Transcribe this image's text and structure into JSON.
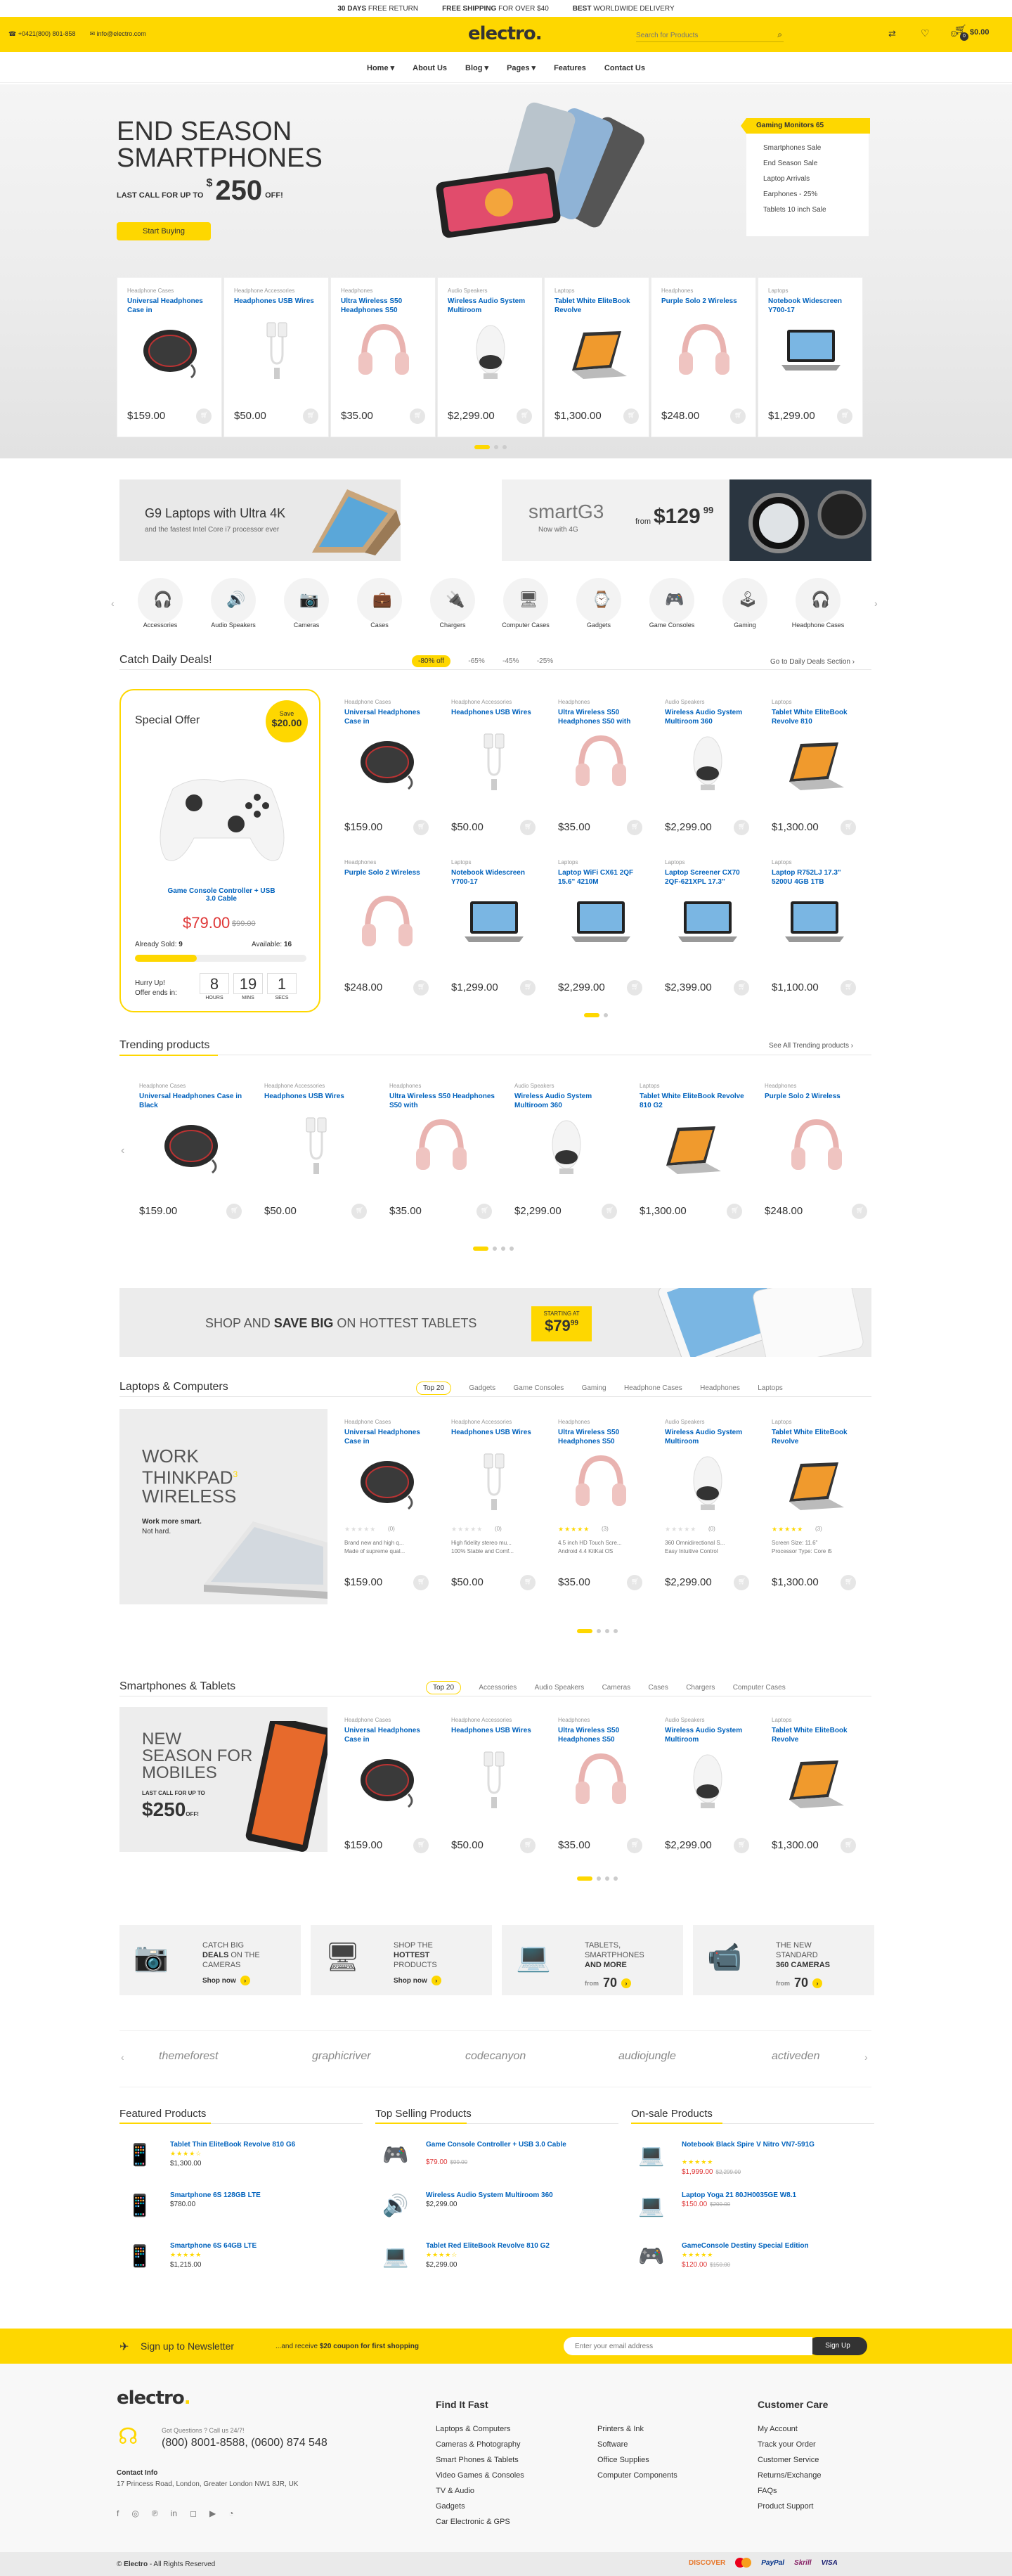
{
  "topbar": {
    "items": [
      {
        "bold": "30 DAYS",
        "text": " FREE RETURN"
      },
      {
        "bold": "FREE SHIPPING",
        "text": " FOR OVER $40"
      },
      {
        "bold": "BEST",
        "text": " WORLDWIDE DELIVERY"
      }
    ]
  },
  "header": {
    "phone": "+0421(800) 801-858",
    "email": "info@electro.com",
    "logo": "electro",
    "search_placeholder": "Search for Products",
    "cart_count": "0",
    "cart_total": "$0.00"
  },
  "nav": [
    "Home",
    "About Us",
    "Blog",
    "Pages",
    "Features",
    "Contact Us"
  ],
  "hero": {
    "line1": "END SEASON",
    "line2": "SMARTPHONES",
    "last_call": "LAST CALL FOR UP TO",
    "currency": "$",
    "amount": "250",
    "off": "OFF!",
    "button": "Start Buying",
    "side_menu": [
      "Gaming Monitors 65",
      "Smartphones Sale",
      "End Season Sale",
      "Laptop Arrivals",
      "Earphones - 25%",
      "Tablets 10 inch Sale"
    ]
  },
  "hero_products": [
    {
      "cat": "Headphone Cases",
      "title": "Universal Headphones Case in",
      "price": "$159.00",
      "img": "case"
    },
    {
      "cat": "Headphone Accessories",
      "title": "Headphones USB Wires",
      "price": "$50.00",
      "img": "wire"
    },
    {
      "cat": "Headphones",
      "title": "Ultra Wireless S50 Headphones S50",
      "price": "$35.00",
      "img": "headphones"
    },
    {
      "cat": "Audio Speakers",
      "title": "Wireless Audio System Multiroom",
      "price": "$2,299.00",
      "img": "speaker"
    },
    {
      "cat": "Laptops",
      "title": "Tablet White EliteBook Revolve",
      "price": "$1,300.00",
      "img": "laptop"
    },
    {
      "cat": "Headphones",
      "title": "Purple Solo 2 Wireless",
      "price": "$248.00",
      "img": "headphones"
    },
    {
      "cat": "Laptops",
      "title": "Notebook Widescreen Y700-17",
      "price": "$1,299.00",
      "img": "notebook"
    }
  ],
  "banners": {
    "b1_title": "G9 Laptops with Ultra 4K",
    "b1_sub": "and the fastest Intel Core i7 processor ever",
    "b2_title": "smartG3",
    "b2_sub": "Now with 4G",
    "b2_from": "from",
    "b2_price": "$129",
    "b2_cents": "99"
  },
  "categories": [
    "Accessories",
    "Audio Speakers",
    "Cameras",
    "Cases",
    "Chargers",
    "Computer Cases",
    "Gadgets",
    "Game Consoles",
    "Gaming",
    "Headphone Cases"
  ],
  "deals": {
    "title": "Catch Daily Deals!",
    "tabs": [
      "-80% off",
      "-65%",
      "-45%",
      "-25%"
    ],
    "go_link": "Go to Daily Deals Section",
    "special_offer": "Special Offer",
    "save_label": "Save",
    "save_amount": "$20.00",
    "special_title": "Game Console Controller + USB 3.0 Cable",
    "special_price": "$79.00",
    "special_old": "$99.00",
    "sold_label": "Already Sold:",
    "sold": "9",
    "avail_label": "Available:",
    "avail": "16",
    "sold_fraction": 0.36,
    "hurry": "Hurry Up!",
    "ends": "Offer ends in:",
    "timer": [
      {
        "v": "8",
        "l": "HOURS"
      },
      {
        "v": "19",
        "l": "MINS"
      },
      {
        "v": "1",
        "l": "SECS"
      }
    ],
    "products": [
      {
        "cat": "Headphone Cases",
        "title": "Universal Headphones Case in",
        "price": "$159.00",
        "img": "case"
      },
      {
        "cat": "Headphone Accessories",
        "title": "Headphones USB Wires",
        "price": "$50.00",
        "img": "wire"
      },
      {
        "cat": "Headphones",
        "title": "Ultra Wireless S50 Headphones S50 with",
        "price": "$35.00",
        "img": "headphones"
      },
      {
        "cat": "Audio Speakers",
        "title": "Wireless Audio System Multiroom 360",
        "price": "$2,299.00",
        "img": "speaker"
      },
      {
        "cat": "Laptops",
        "title": "Tablet White EliteBook Revolve 810",
        "price": "$1,300.00",
        "img": "laptop"
      },
      {
        "cat": "Headphones",
        "title": "Purple Solo 2 Wireless",
        "price": "$248.00",
        "img": "headphones"
      },
      {
        "cat": "Laptops",
        "title": "Notebook Widescreen Y700-17",
        "price": "$1,299.00",
        "img": "notebook"
      },
      {
        "cat": "Laptops",
        "title": "Laptop WiFi CX61 2QF 15.6\" 4210M",
        "price": "$2,299.00",
        "img": "notebook"
      },
      {
        "cat": "Laptops",
        "title": "Laptop Screener CX70 2QF-621XPL 17.3\"",
        "price": "$2,399.00",
        "img": "notebook"
      },
      {
        "cat": "Laptops",
        "title": "Laptop R752LJ 17.3\" 5200U 4GB 1TB",
        "price": "$1,100.00",
        "img": "notebook"
      }
    ]
  },
  "trending": {
    "title": "Trending products",
    "link": "See All Trending products",
    "products": [
      {
        "cat": "Headphone Cases",
        "title": "Universal Headphones Case in Black",
        "price": "$159.00",
        "img": "case"
      },
      {
        "cat": "Headphone Accessories",
        "title": "Headphones USB Wires",
        "price": "$50.00",
        "img": "wire"
      },
      {
        "cat": "Headphones",
        "title": "Ultra Wireless S50 Headphones S50 with",
        "price": "$35.00",
        "img": "headphones"
      },
      {
        "cat": "Audio Speakers",
        "title": "Wireless Audio System Multiroom 360",
        "price": "$2,299.00",
        "img": "speaker"
      },
      {
        "cat": "Laptops",
        "title": "Tablet White EliteBook Revolve 810 G2",
        "price": "$1,300.00",
        "img": "laptop"
      },
      {
        "cat": "Headphones",
        "title": "Purple Solo 2 Wireless",
        "price": "$248.00",
        "img": "headphones"
      }
    ]
  },
  "tablet_banner": {
    "pre": "SHOP AND ",
    "bold": "SAVE BIG",
    "post": " ON HOTTEST TABLETS",
    "starting": "STARTING AT",
    "price": "$79",
    "cents": "99"
  },
  "laptops": {
    "title": "Laptops & Computers",
    "tabs": [
      "Top 20",
      "Gadgets",
      "Game Consoles",
      "Gaming",
      "Headphone Cases",
      "Headphones",
      "Laptops"
    ],
    "promo_l1": "WORK",
    "promo_l2": "THINKPAD",
    "promo_sup": "3",
    "promo_l3": "WIRELESS",
    "promo_sub1": "Work more smart.",
    "promo_sub2": "Not hard.",
    "products": [
      {
        "cat": "Headphone Cases",
        "title": "Universal Headphones Case in",
        "price": "$159.00",
        "img": "case",
        "reviews": "(0)",
        "bullets": [
          "Brand new and high q...",
          "Made of supreme qual..."
        ]
      },
      {
        "cat": "Headphone Accessories",
        "title": "Headphones USB Wires",
        "price": "$50.00",
        "img": "wire",
        "reviews": "(0)",
        "bullets": [
          "High fidelity stereo mu...",
          "100% Stable and Comf..."
        ]
      },
      {
        "cat": "Headphones",
        "title": "Ultra Wireless S50 Headphones S50",
        "price": "$35.00",
        "img": "headphones",
        "reviews": "(3)",
        "bullets": [
          "4.5 inch HD Touch Scre...",
          "Android 4.4 KitKat OS"
        ]
      },
      {
        "cat": "Audio Speakers",
        "title": "Wireless Audio System Multiroom",
        "price": "$2,299.00",
        "img": "speaker",
        "reviews": "(0)",
        "bullets": [
          "360 Omnidirectional S...",
          "Easy Intuitive Control"
        ]
      },
      {
        "cat": "Laptops",
        "title": "Tablet White EliteBook Revolve",
        "price": "$1,300.00",
        "img": "laptop",
        "reviews": "(3)",
        "bullets": [
          "Screen Size: 11.6\"",
          "Processor Type: Core i5"
        ]
      }
    ]
  },
  "smartphones": {
    "title": "Smartphones & Tablets",
    "tabs": [
      "Top 20",
      "Accessories",
      "Audio Speakers",
      "Cameras",
      "Cases",
      "Chargers",
      "Computer Cases"
    ],
    "promo_l1": "NEW",
    "promo_l2": "SEASON FOR",
    "promo_l3": "MOBILES",
    "promo_call": "LAST CALL FOR UP TO",
    "promo_price": "$250",
    "promo_off": "OFF!",
    "products": [
      {
        "cat": "Headphone Cases",
        "title": "Universal Headphones Case in",
        "price": "$159.00",
        "img": "case"
      },
      {
        "cat": "Headphone Accessories",
        "title": "Headphones USB Wires",
        "price": "$50.00",
        "img": "wire"
      },
      {
        "cat": "Headphones",
        "title": "Ultra Wireless S50 Headphones S50",
        "price": "$35.00",
        "img": "headphones"
      },
      {
        "cat": "Audio Speakers",
        "title": "Wireless Audio System Multiroom",
        "price": "$2,299.00",
        "img": "speaker"
      },
      {
        "cat": "Laptops",
        "title": "Tablet White EliteBook Revolve",
        "price": "$1,300.00",
        "img": "laptop"
      }
    ]
  },
  "promos": [
    {
      "l1": "CATCH BIG",
      "l2b": "DEALS",
      "l2": " ON THE",
      "l3": "CAMERAS",
      "cta": "Shop now"
    },
    {
      "l1": "SHOP THE",
      "l2b": "HOTTEST",
      "l2": "",
      "l3": "PRODUCTS",
      "cta": "Shop now"
    },
    {
      "l1": "TABLETS,",
      "l2b": "",
      "l2": "SMARTPHONES",
      "l3": "AND MORE",
      "cta": "70"
    },
    {
      "l1": "THE NEW",
      "l2b": "",
      "l2": "STANDARD",
      "l3": "360 CAMERAS",
      "cta": "70"
    }
  ],
  "brands": [
    "themeforest",
    "graphicriver",
    "codecanyon",
    "audiojungle",
    "activeden"
  ],
  "lists": [
    {
      "title": "Featured Products",
      "items": [
        {
          "name": "Tablet Thin EliteBook Revolve 810 G6",
          "stars": 4,
          "price": "$1,300.00",
          "old": ""
        },
        {
          "name": "Smartphone 6S 128GB LTE",
          "stars": 0,
          "price": "$780.00",
          "old": ""
        },
        {
          "name": "Smartphone 6S 64GB LTE",
          "stars": 5,
          "price": "$1,215.00",
          "old": ""
        }
      ]
    },
    {
      "title": "Top Selling Products",
      "items": [
        {
          "name": "Game Console Controller + USB 3.0 Cable",
          "stars": 0,
          "price": "$79.00",
          "old": "$99.00"
        },
        {
          "name": "Wireless Audio System Multiroom 360",
          "stars": 0,
          "price": "$2,299.00",
          "old": ""
        },
        {
          "name": "Tablet Red EliteBook Revolve 810 G2",
          "stars": 4,
          "price": "$2,299.00",
          "old": ""
        }
      ]
    },
    {
      "title": "On-sale Products",
      "items": [
        {
          "name": "Notebook Black Spire V Nitro VN7-591G",
          "stars": 5,
          "price": "$1,999.00",
          "old": "$2,299.00"
        },
        {
          "name": "Laptop Yoga 21 80JH0035GE W8.1",
          "stars": 0,
          "price": "$150.00",
          "old": "$200.00"
        },
        {
          "name": "GameConsole Destiny Special Edition",
          "stars": 5,
          "price": "$120.00",
          "old": "$150.00"
        }
      ]
    }
  ],
  "newsletter": {
    "label": "Sign up to Newsletter",
    "pre": "...and receive ",
    "bold": "$20 coupon for first shopping",
    "placeholder": "Enter your email address",
    "button": "Sign Up"
  },
  "footer": {
    "logo": "electro",
    "question": "Got Questions ? Call us 24/7!",
    "phones": "(800) 8001-8588, (0600) 874 548",
    "contact_title": "Contact Info",
    "address": "17 Princess Road, London, Greater London NW1 8JR, UK",
    "col1_title": "Find It Fast",
    "col1": [
      "Laptops & Computers",
      "Cameras & Photography",
      "Smart Phones & Tablets",
      "Video Games & Consoles",
      "TV & Audio",
      "Gadgets",
      "Car Electronic & GPS"
    ],
    "col2": [
      "Printers & Ink",
      "Software",
      "Office Supplies",
      "Computer Components"
    ],
    "col3_title": "Customer Care",
    "col3": [
      "My Account",
      "Track your Order",
      "Customer Service",
      "Returns/Exchange",
      "FAQs",
      "Product Support"
    ],
    "copyright_brand": "Electro",
    "copyright": " - All Rights Reserved",
    "payments": [
      "DISCOVER",
      "",
      "PayPal",
      "Skrill",
      "VISA"
    ]
  },
  "colors": {
    "accent": "#fed700",
    "link": "#0062bd",
    "sale": "#df3737"
  }
}
